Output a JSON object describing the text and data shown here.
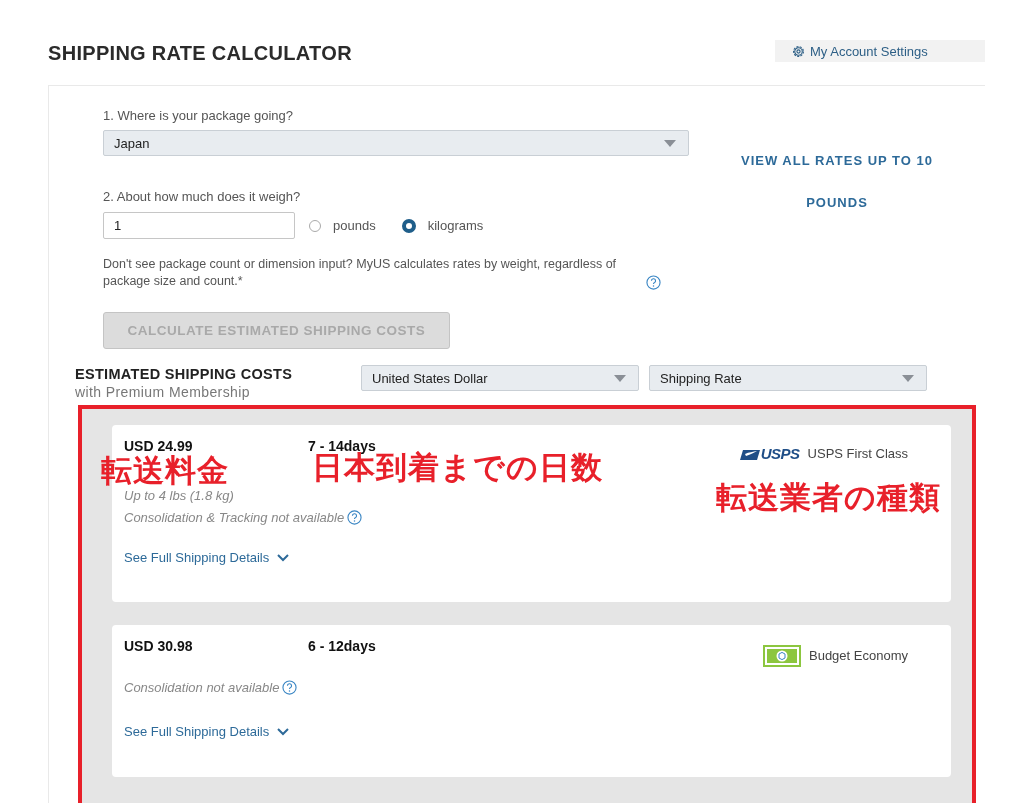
{
  "header": {
    "title": "SHIPPING RATE CALCULATOR",
    "account_link": "My Account Settings"
  },
  "form": {
    "destination_label": "1. Where is your package going?",
    "destination": "Japan",
    "weight_label": "2. About how much does it weigh?",
    "weight": "1",
    "units": [
      {
        "label": "pounds",
        "selected": false
      },
      {
        "label": "kilograms",
        "selected": true
      }
    ],
    "note": "Don't see package count or dimension input? MyUS calculates rates by weight, regardless of package size and count.*",
    "calculate_button": {
      "label": "CALCULATE ESTIMATED SHIPPING COSTS",
      "disabled": true
    }
  },
  "view_all_link": "VIEW ALL RATES UP TO 10 POUNDS",
  "results": {
    "title": "ESTIMATED SHIPPING COSTS",
    "subtitle": "with Premium Membership",
    "currency": "United States Dollar",
    "sort": "Shipping Rate",
    "rates": [
      {
        "price": "USD 24.99",
        "days": "7 - 14days",
        "kind": "usps",
        "logo_text": "USPS",
        "carrier": "USPS First Class",
        "limit": "Up to 4 lbs (1.8 kg)",
        "availability": "Consolidation & Tracking not available",
        "details_link": "See Full Shipping Details"
      },
      {
        "price": "USD 30.98",
        "days": "6 - 12days",
        "kind": "budget",
        "carrier": "Budget Economy",
        "availability": "Consolidation not available",
        "details_link": "See Full Shipping Details"
      }
    ]
  },
  "annotations": [
    {
      "text": "転送料金"
    },
    {
      "text": "日本到着までの日数"
    },
    {
      "text": "転送業者の種類"
    }
  ]
}
